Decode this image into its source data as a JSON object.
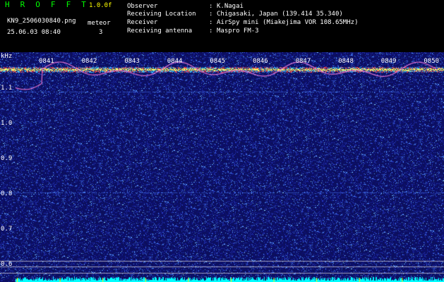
{
  "header": {
    "app_title": "H R O F F T",
    "version": "1.0.0f",
    "filename": "KN9_2506030840.png",
    "datetime": "25.06.03 08:40",
    "meteor_label": "meteor",
    "meteor_count": "3",
    "info": [
      {
        "label": "Observer",
        "value": "K.Nagai"
      },
      {
        "label": "Receiving Location",
        "value": "Chigasaki, Japan (139.414 35.340)"
      },
      {
        "label": "Receiver",
        "value": "AirSpy mini (Miakejima VOR 108.65MHz)"
      },
      {
        "label": "Receiving antenna",
        "value": "Maspro FM-3"
      }
    ]
  },
  "spectrogram": {
    "unit": "kHz",
    "y_ticks": [
      "1.1",
      "1.0",
      "0.9",
      "0.8",
      "0.7",
      "0.6"
    ],
    "time_labels": [
      "0841",
      "0842",
      "0843",
      "0844",
      "0845",
      "0846",
      "0847",
      "0848",
      "0849",
      "0850"
    ],
    "background_color": "#0c0f5a",
    "carrier_color": "#ffff66",
    "baseline_color": "#00ffff"
  }
}
